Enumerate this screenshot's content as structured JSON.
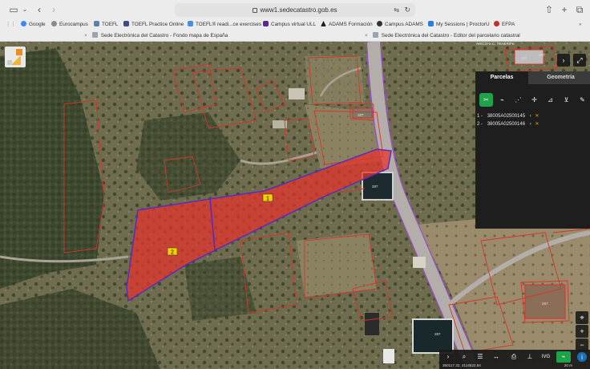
{
  "browser": {
    "url": "www1.sedecatastro.gob.es",
    "bookmarks": [
      {
        "label": "Google",
        "color": "#4285f4"
      },
      {
        "label": "Eurocampus",
        "color": "#8a8a8a"
      },
      {
        "label": "TOEFL",
        "color": "#5a7fb3"
      },
      {
        "label": "TOEFL Practice Online",
        "color": "#3b4f7a"
      },
      {
        "label": "TOEFL® readi...ce exercises",
        "color": "#4a90d9"
      },
      {
        "label": "Campus virtual ULL",
        "color": "#5b2a86"
      },
      {
        "label": "ADAMS Formación",
        "color": "#222222"
      },
      {
        "label": "Campus ADAMS",
        "color": "#333333"
      },
      {
        "label": "My Sessions | ProctorU",
        "color": "#2f7bd6"
      },
      {
        "label": "EFPA",
        "color": "#c4302b"
      }
    ],
    "tabs": [
      {
        "label": "Sede Electrónica del Catastro - Fondo mapa de España"
      },
      {
        "label": "Sede Electrónica del Catastro - Editor del parcelario catastral"
      }
    ]
  },
  "panel": {
    "tab_parcelas": "Parcelas",
    "tab_geometria": "Geometría",
    "parcels": [
      {
        "index": "1 -",
        "ref": "38005A02500145"
      },
      {
        "index": "2 -",
        "ref": "38005A02500146"
      }
    ]
  },
  "map": {
    "parcel_labels": [
      "1",
      "2"
    ],
    "building_codes": [
      "287",
      "287",
      "287",
      "287",
      "287",
      "287"
    ],
    "place_label": "ARICO-S.C. TENERIFE",
    "coords": "350117.32, 3114522.84",
    "scale": "20 m"
  },
  "colors": {
    "parcel_fill": "#e8322a",
    "parcel_outline": "#5a2dbd",
    "cadastre_line": "#d6342c",
    "active_tool": "#1ea34a",
    "accent_arrow": "#f1a21b"
  }
}
